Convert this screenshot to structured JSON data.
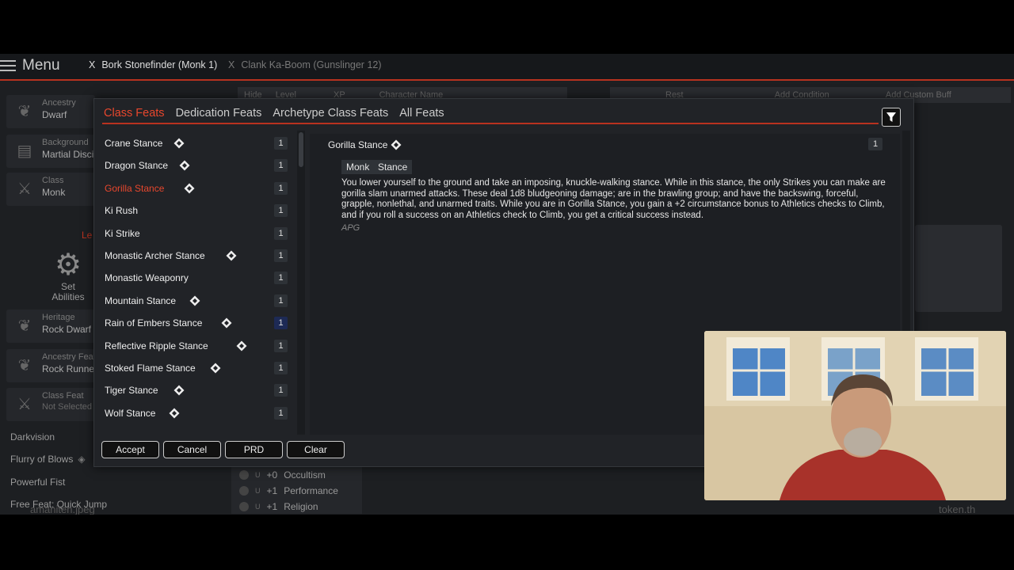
{
  "topbar": {
    "menu_label": "Menu",
    "characters": [
      {
        "close": "X",
        "name": "Bork Stonefinder (Monk 1)"
      },
      {
        "close": "X",
        "name": "Clank Ka-Boom (Gunslinger 12)"
      }
    ]
  },
  "sidebar": {
    "cards": [
      {
        "label": "Ancestry",
        "value": "Dwarf"
      },
      {
        "label": "Background",
        "value": "Martial Disci"
      },
      {
        "label": "Class",
        "value": "Monk"
      },
      {
        "label": "Heritage",
        "value": "Rock Dwarf"
      },
      {
        "label": "Ancestry Feat",
        "value": "Rock Runner"
      },
      {
        "label": "Class Feat",
        "value": "Not Selected"
      }
    ],
    "level_fragment": "Le",
    "set_abilities": "Set Abilities",
    "features": [
      "Darkvision",
      "Flurry of Blows",
      "Powerful Fist",
      "Free Feat: Quick Jump"
    ]
  },
  "background_bar": {
    "hide": "Hide",
    "level_placeholder": "Level",
    "xp_placeholder": "XP",
    "name_placeholder": "Character Name",
    "rest": "Rest",
    "add_condition": "Add Condition",
    "add_custom_buff": "Add Custom Buff"
  },
  "skills": [
    {
      "prof": "U",
      "mod": "+0",
      "name": "Occultism"
    },
    {
      "prof": "U",
      "mod": "+1",
      "name": "Performance"
    },
    {
      "prof": "U",
      "mod": "+1",
      "name": "Religion"
    }
  ],
  "footer": {
    "left_file": "amaniten.jpeg",
    "right_file": "token.th"
  },
  "dialog": {
    "tabs": [
      "Class Feats",
      "Dedication Feats",
      "Archetype Class Feats",
      "All Feats"
    ],
    "active_tab": "Class Feats",
    "feats": [
      {
        "name": "Crane Stance",
        "action": true,
        "level": "1"
      },
      {
        "name": "Dragon Stance",
        "action": true,
        "level": "1"
      },
      {
        "name": "Gorilla Stance",
        "action": true,
        "level": "1",
        "selected": true
      },
      {
        "name": "Ki Rush",
        "action": false,
        "level": "1"
      },
      {
        "name": "Ki Strike",
        "action": false,
        "level": "1"
      },
      {
        "name": "Monastic Archer Stance",
        "action": true,
        "level": "1"
      },
      {
        "name": "Monastic Weaponry",
        "action": false,
        "level": "1"
      },
      {
        "name": "Mountain Stance",
        "action": true,
        "level": "1"
      },
      {
        "name": "Rain of Embers Stance",
        "action": true,
        "level": "1",
        "highlight": true
      },
      {
        "name": "Reflective Ripple Stance",
        "action": true,
        "level": "1"
      },
      {
        "name": "Stoked Flame Stance",
        "action": true,
        "level": "1"
      },
      {
        "name": "Tiger Stance",
        "action": true,
        "level": "1"
      },
      {
        "name": "Wolf Stance",
        "action": true,
        "level": "1"
      }
    ],
    "detail": {
      "name": "Gorilla Stance",
      "level": "1",
      "traits": [
        "Monk",
        "Stance"
      ],
      "description": "You lower yourself to the ground and take an imposing, knuckle-walking stance. While in this stance, the only Strikes you can make are gorilla slam unarmed attacks. These deal 1d8 bludgeoning damage; are in the brawling group; and have the backswing, forceful, grapple, nonlethal, and unarmed traits. While you are in Gorilla Stance, you gain a +2 circumstance bonus to Athletics checks to Climb, and if you roll a success on an Athletics check to Climb, you get a critical success instead.",
      "source": "APG"
    },
    "buttons": {
      "accept": "Accept",
      "cancel": "Cancel",
      "prd": "PRD",
      "clear": "Clear"
    }
  }
}
